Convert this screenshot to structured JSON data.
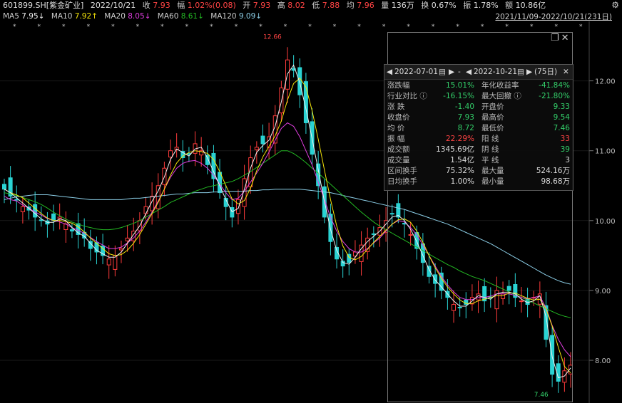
{
  "header": {
    "symbol": "601899.SH[紫金矿业]",
    "date": "2022/10/21",
    "close_label": "收",
    "close": "7.93",
    "change_label": "幅",
    "change": "1.02%(0.08)",
    "open_label": "开",
    "open": "7.93",
    "high_label": "高",
    "high": "8.02",
    "low_label": "低",
    "low": "7.88",
    "avg_label": "均",
    "avg": "7.96",
    "volume_label": "量",
    "volume": "136万",
    "turnover_label": "换",
    "turnover": "0.67%",
    "amplitude_label": "振",
    "amplitude": "1.78%",
    "amount_label": "额",
    "amount": "10.86亿"
  },
  "ma_row": {
    "ma5_label": "MA5",
    "ma5": "7.95↓",
    "ma10_label": "MA10",
    "ma10": "7.92↑",
    "ma20_label": "MA20",
    "ma20": "8.05↓",
    "ma60_label": "MA60",
    "ma60": "8.61↓",
    "ma120_label": "MA120",
    "ma120": "9.09↓",
    "range": "2021/11/09-2022/10/21(231日)"
  },
  "colors": {
    "up": "#ff3b3b",
    "down": "#2ad3d3",
    "ma5": "#f0f0f0",
    "ma10": "#f5e50a",
    "ma20": "#e03ee0",
    "ma60": "#23b823",
    "ma120": "#8ccfe8"
  },
  "icons": {
    "settings": "gear-icon",
    "restore": "restore-icon",
    "close": "close-icon"
  },
  "chart_data": {
    "type": "candlestick",
    "yticks": [
      "12.00",
      "11.00",
      "10.00",
      "9.00",
      "8.00"
    ],
    "ylim": [
      7.45,
      12.75
    ],
    "max_label": "12.66",
    "min_label": "7.46",
    "closes": [
      10.45,
      10.35,
      10.3,
      10.2,
      10.15,
      10.05,
      10.0,
      9.95,
      10.0,
      10.05,
      9.95,
      9.85,
      9.8,
      9.75,
      9.6,
      9.55,
      9.5,
      9.45,
      9.5,
      9.6,
      9.75,
      9.85,
      10.0,
      10.2,
      10.35,
      10.5,
      10.75,
      11.0,
      11.05,
      10.9,
      10.95,
      11.1,
      11.0,
      10.8,
      10.6,
      10.4,
      10.2,
      10.05,
      10.3,
      10.6,
      10.9,
      11.05,
      11.1,
      11.2,
      11.5,
      11.9,
      12.3,
      12.15,
      11.8,
      11.4,
      10.95,
      10.5,
      10.05,
      9.7,
      9.45,
      9.35,
      9.4,
      9.55,
      9.65,
      9.75,
      9.8,
      9.9,
      10.0,
      10.1,
      10.05,
      9.95,
      9.8,
      9.6,
      9.4,
      9.2,
      9.1,
      9.0,
      8.9,
      8.8,
      8.75,
      8.8,
      8.9,
      8.95,
      8.85,
      8.9,
      9.0,
      8.95,
      9.0,
      8.9,
      8.85,
      8.8,
      8.9,
      8.95,
      8.3,
      7.8,
      7.7,
      7.85,
      7.93
    ],
    "ma20": [
      10.35,
      10.3,
      10.28,
      10.22,
      10.18,
      10.12,
      10.08,
      10.03,
      10.0,
      9.98,
      9.95,
      9.9,
      9.86,
      9.82,
      9.76,
      9.7,
      9.65,
      9.6,
      9.6,
      9.62,
      9.68,
      9.75,
      9.85,
      9.98,
      10.12,
      10.28,
      10.45,
      10.62,
      10.75,
      10.82,
      10.85,
      10.86,
      10.82,
      10.75,
      10.65,
      10.52,
      10.4,
      10.3,
      10.32,
      10.42,
      10.55,
      10.68,
      10.82,
      10.98,
      11.15,
      11.32,
      11.4,
      11.35,
      11.2,
      11.0,
      10.8,
      10.55,
      10.3,
      10.05,
      9.85,
      9.7,
      9.6,
      9.55,
      9.55,
      9.6,
      9.68,
      9.75,
      9.85,
      9.95,
      10.0,
      9.98,
      9.9,
      9.8,
      9.65,
      9.5,
      9.35,
      9.2,
      9.08,
      8.98,
      8.9,
      8.87,
      8.87,
      8.9,
      8.9,
      8.92,
      8.95,
      8.95,
      8.95,
      8.93,
      8.9,
      8.88,
      8.9,
      8.92,
      8.75,
      8.5,
      8.3,
      8.15,
      8.05
    ],
    "ma60": [
      10.4,
      10.38,
      10.36,
      10.33,
      10.3,
      10.27,
      10.23,
      10.18,
      10.12,
      10.07,
      10.02,
      9.98,
      9.95,
      9.92,
      9.9,
      9.88,
      9.87,
      9.87,
      9.88,
      9.9,
      9.93,
      9.96,
      10.0,
      10.05,
      10.1,
      10.15,
      10.2,
      10.26,
      10.3,
      10.34,
      10.38,
      10.42,
      10.45,
      10.48,
      10.5,
      10.52,
      10.54,
      10.56,
      10.6,
      10.65,
      10.7,
      10.76,
      10.82,
      10.88,
      10.94,
      11.0,
      11.0,
      10.96,
      10.9,
      10.83,
      10.75,
      10.68,
      10.6,
      10.52,
      10.44,
      10.36,
      10.28,
      10.2,
      10.12,
      10.05,
      9.98,
      9.92,
      9.87,
      9.82,
      9.77,
      9.72,
      9.67,
      9.62,
      9.57,
      9.52,
      9.47,
      9.42,
      9.37,
      9.33,
      9.28,
      9.24,
      9.2,
      9.17,
      9.14,
      9.1,
      9.06,
      9.02,
      8.98,
      8.94,
      8.9,
      8.86,
      8.82,
      8.78,
      8.74,
      8.7,
      8.66,
      8.63,
      8.61
    ],
    "ma120": [
      10.3,
      10.32,
      10.34,
      10.35,
      10.36,
      10.37,
      10.37,
      10.37,
      10.36,
      10.35,
      10.34,
      10.33,
      10.32,
      10.31,
      10.3,
      10.3,
      10.3,
      10.3,
      10.3,
      10.3,
      10.31,
      10.32,
      10.32,
      10.33,
      10.34,
      10.35,
      10.36,
      10.37,
      10.38,
      10.38,
      10.39,
      10.4,
      10.4,
      10.4,
      10.41,
      10.41,
      10.42,
      10.42,
      10.42,
      10.42,
      10.43,
      10.43,
      10.44,
      10.44,
      10.45,
      10.45,
      10.45,
      10.45,
      10.45,
      10.44,
      10.43,
      10.42,
      10.41,
      10.4,
      10.38,
      10.36,
      10.34,
      10.32,
      10.3,
      10.28,
      10.26,
      10.24,
      10.22,
      10.2,
      10.18,
      10.16,
      10.13,
      10.1,
      10.07,
      10.04,
      10.01,
      9.98,
      9.95,
      9.91,
      9.87,
      9.83,
      9.79,
      9.75,
      9.71,
      9.67,
      9.62,
      9.57,
      9.52,
      9.47,
      9.42,
      9.37,
      9.32,
      9.27,
      9.22,
      9.18,
      9.14,
      9.11,
      9.09
    ]
  },
  "stats": {
    "start_date": "2022-07-01",
    "end_date": "2022-10-21",
    "days": "(75日)",
    "rows": [
      {
        "lk": "涨跌幅",
        "lv": "15.01%",
        "lc": "g",
        "rk": "年化收益率",
        "rv": "-41.84%",
        "rc": "g"
      },
      {
        "lk": "行业对比 ⓘ",
        "lv": "-16.15%",
        "lc": "g",
        "rk": "最大回撤 ⓘ",
        "rv": "-21.80%",
        "rc": "g"
      },
      {
        "lk": "涨  跌",
        "lv": "-1.40",
        "lc": "g",
        "rk": "开盘价",
        "rv": "9.33",
        "rc": "g"
      },
      {
        "lk": "收盘价",
        "lv": "7.93",
        "lc": "g",
        "rk": "最高价",
        "rv": "9.54",
        "rc": "g"
      },
      {
        "lk": "均  价",
        "lv": "8.72",
        "lc": "g",
        "rk": "最低价",
        "rv": "7.46",
        "rc": "g"
      },
      {
        "lk": "振  幅",
        "lv": "22.29%",
        "lc": "r",
        "rk": "阳  线",
        "rv": "33",
        "rc": "r"
      },
      {
        "lk": "成交额",
        "lv": "1345.69亿",
        "lc": "w",
        "rk": "阴  线",
        "rv": "39",
        "rc": "g"
      },
      {
        "lk": "成交量",
        "lv": "1.54亿",
        "lc": "w",
        "rk": "平  线",
        "rv": "3",
        "rc": "w"
      },
      {
        "lk": "区间换手",
        "lv": "75.32%",
        "lc": "w",
        "rk": "最大量",
        "rv": "524.16万",
        "rc": "w"
      },
      {
        "lk": "日均换手",
        "lv": "1.00%",
        "lc": "w",
        "rk": "最小量",
        "rv": "98.68万",
        "rc": "w"
      }
    ]
  }
}
